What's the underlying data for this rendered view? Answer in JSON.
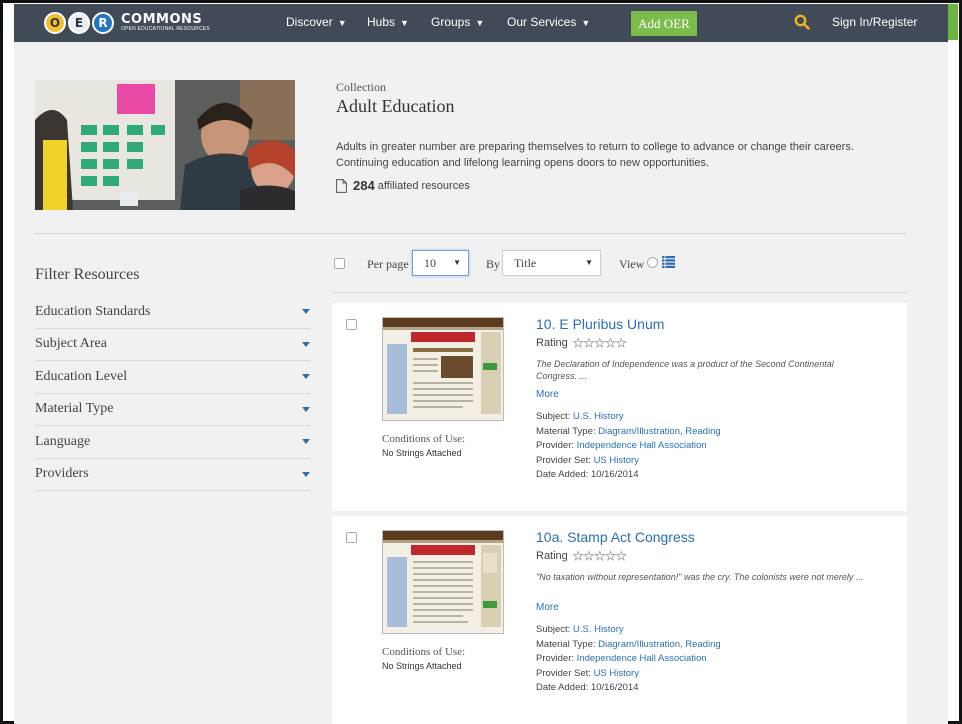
{
  "nav": {
    "logo_letters": [
      "O",
      "E",
      "R"
    ],
    "logo_name": "COMMONS",
    "logo_tagline": "OPEN EDUCATIONAL RESOURCES",
    "items": [
      "Discover",
      "Hubs",
      "Groups",
      "Our Services"
    ],
    "add_oer": "Add OER",
    "signin": "Sign In/Register"
  },
  "collection": {
    "label": "Collection",
    "title": "Adult Education",
    "description": "Adults in greater number are preparing themselves to return to college to advance or change their careers. Continuing education and lifelong learning opens doors to new opportunities.",
    "resource_count": "284",
    "resource_suffix": "affiliated resources"
  },
  "filters": {
    "title": "Filter Resources",
    "items": [
      "Education Standards",
      "Subject Area",
      "Education Level",
      "Material Type",
      "Language",
      "Providers"
    ]
  },
  "toolbar": {
    "per_page_label": "Per page",
    "per_page_value": "10",
    "by_label": "By",
    "by_value": "Title",
    "view_label": "View"
  },
  "results": [
    {
      "title": "10. E Pluribus Unum",
      "rating_label": "Rating",
      "rating": 0,
      "description": "The Declaration of Independence was a product of the Second Continental Congress. ...",
      "more": "More",
      "conditions_label": "Conditions of Use:",
      "conditions_value": "No Strings Attached",
      "subject_label": "Subject:",
      "subject": "U.S. History",
      "material_label": "Material Type:",
      "material": "Diagram/Illustration, Reading",
      "provider_label": "Provider:",
      "provider": "Independence Hall Association",
      "provider_set_label": "Provider Set:",
      "provider_set": "US History",
      "date_label": "Date Added:",
      "date": "10/16/2014"
    },
    {
      "title": "10a. Stamp Act Congress",
      "rating_label": "Rating",
      "rating": 0,
      "description": "\"No taxation without representation!\" was the cry. The colonists were not merely ...",
      "more": "More",
      "conditions_label": "Conditions of Use:",
      "conditions_value": "No Strings Attached",
      "subject_label": "Subject:",
      "subject": "U.S. History",
      "material_label": "Material Type:",
      "material": "Diagram/Illustration, Reading",
      "provider_label": "Provider:",
      "provider": "Independence Hall Association",
      "provider_set_label": "Provider Set:",
      "provider_set": "US History",
      "date_label": "Date Added:",
      "date": "10/16/2014"
    }
  ],
  "colors": {
    "nav_bg": "#414a57",
    "add_button": "#7dbb4d",
    "link": "#2a6fb5",
    "search_icon": "#f2b320"
  }
}
